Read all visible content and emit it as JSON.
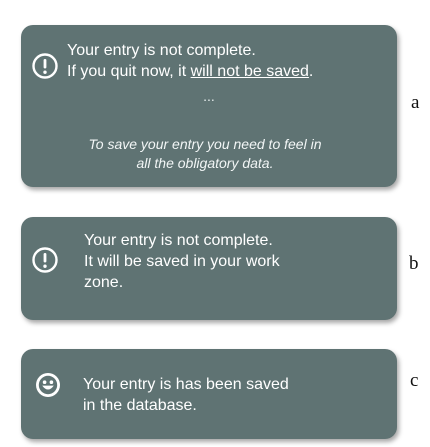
{
  "notices": {
    "a": {
      "icon": "exclamation-circle-icon",
      "line1": "Your entry is not complete.",
      "line2_prefix": "If you quit now, it ",
      "line2_emphasis": "will not be saved",
      "line2_suffix": ".",
      "ellipsis": "...",
      "hint_line1": "To save your entry you need to feel in",
      "hint_line2": "all the obligatory data.",
      "side_label": "a"
    },
    "b": {
      "icon": "exclamation-circle-icon",
      "line1": "Your entry is not complete.",
      "line2": "It will be saved in your work",
      "line3": "zone.",
      "side_label": "b"
    },
    "c": {
      "icon": "smiley-icon",
      "line1": "Your entry is has been saved",
      "line2": "in the database.",
      "side_label": "c"
    }
  },
  "colors": {
    "card_background": "#5f7373",
    "text": "#ffffff"
  }
}
